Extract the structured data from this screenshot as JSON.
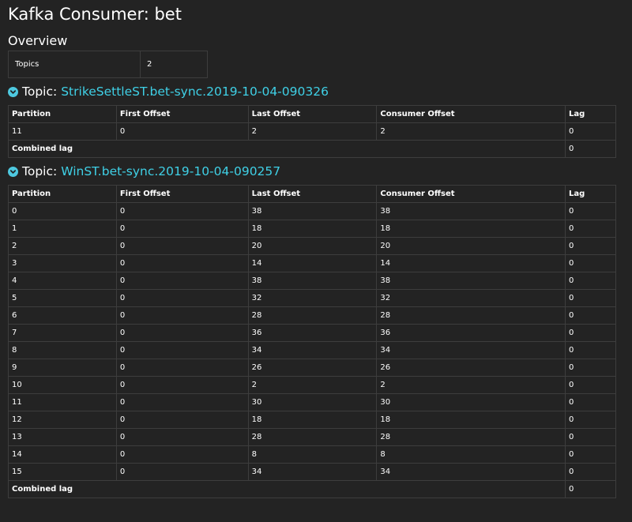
{
  "page": {
    "title": "Kafka Consumer: bet"
  },
  "overview": {
    "title": "Overview",
    "rows": [
      {
        "key": "Topics",
        "value": "2"
      }
    ]
  },
  "columns": [
    "Partition",
    "First Offset",
    "Last Offset",
    "Consumer Offset",
    "Lag"
  ],
  "topics": [
    {
      "prefix": "Topic:",
      "name": "StrikeSettleST.bet-sync.2019-10-04-090326",
      "rows": [
        [
          "11",
          "0",
          "2",
          "2",
          "0"
        ]
      ],
      "combined_label": "Combined lag",
      "combined_value": "0"
    },
    {
      "prefix": "Topic:",
      "name": "WinST.bet-sync.2019-10-04-090257",
      "rows": [
        [
          "0",
          "0",
          "38",
          "38",
          "0"
        ],
        [
          "1",
          "0",
          "18",
          "18",
          "0"
        ],
        [
          "2",
          "0",
          "20",
          "20",
          "0"
        ],
        [
          "3",
          "0",
          "14",
          "14",
          "0"
        ],
        [
          "4",
          "0",
          "38",
          "38",
          "0"
        ],
        [
          "5",
          "0",
          "32",
          "32",
          "0"
        ],
        [
          "6",
          "0",
          "28",
          "28",
          "0"
        ],
        [
          "7",
          "0",
          "36",
          "36",
          "0"
        ],
        [
          "8",
          "0",
          "34",
          "34",
          "0"
        ],
        [
          "9",
          "0",
          "26",
          "26",
          "0"
        ],
        [
          "10",
          "0",
          "2",
          "2",
          "0"
        ],
        [
          "11",
          "0",
          "30",
          "30",
          "0"
        ],
        [
          "12",
          "0",
          "18",
          "18",
          "0"
        ],
        [
          "13",
          "0",
          "28",
          "28",
          "0"
        ],
        [
          "14",
          "0",
          "8",
          "8",
          "0"
        ],
        [
          "15",
          "0",
          "34",
          "34",
          "0"
        ]
      ],
      "combined_label": "Combined lag",
      "combined_value": "0"
    }
  ],
  "colors": {
    "accent": "#3fd0e6",
    "background": "#232323",
    "border": "#3d3d3d"
  },
  "icons": {
    "topic_toggle": "chevron-down-circle-icon"
  }
}
